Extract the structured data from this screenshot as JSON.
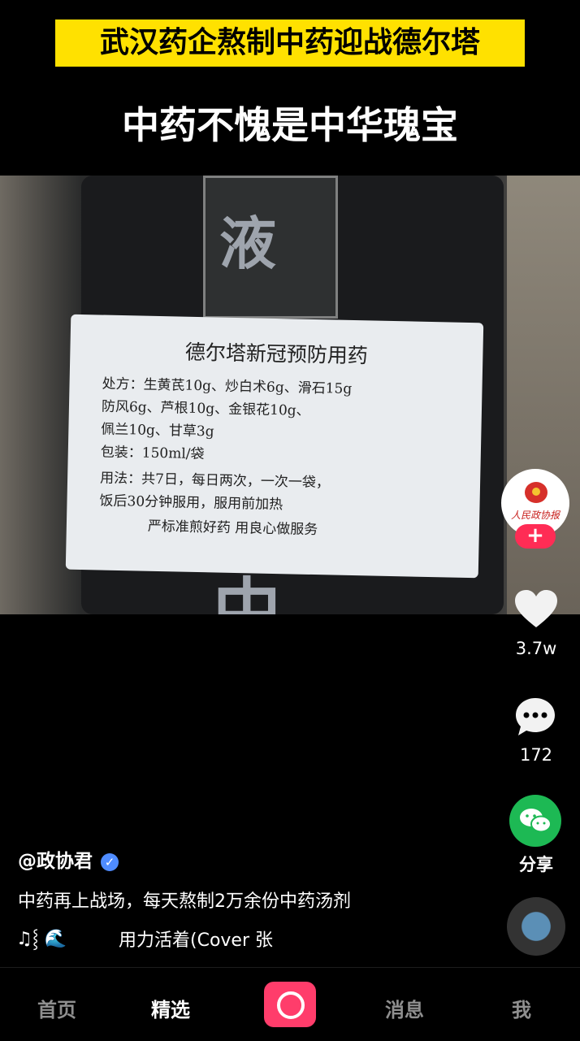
{
  "overlay": {
    "headline": "武汉药企熬制中药迎战德尔塔",
    "subheadline": "中药不愧是中华瑰宝"
  },
  "video": {
    "bag_chars": [
      "液",
      "中"
    ],
    "label": {
      "title": "德尔塔新冠预防用药",
      "lines": [
        "处方：生黄芪10g、炒白术6g、滑石15g",
        "防风6g、芦根10g、金银花10g、",
        "佩兰10g、甘草3g",
        "包装：150ml/袋",
        "用法：共7日，每日两次，一次一袋，",
        "饭后30分钟服用，服用前加热",
        "严标准煎好药 用良心做服务"
      ]
    }
  },
  "sidebar": {
    "avatar_text": "人民政协报",
    "follow_label": "+",
    "likes": "3.7w",
    "comments": "172",
    "share_label": "分享"
  },
  "post": {
    "username": "@政协君",
    "caption": "中药再上战场，每天熬制2万余份中药汤剂",
    "music_icons": "♫⸾ 🌊",
    "song": "用力活着(Cover 张"
  },
  "nav": {
    "home": "首页",
    "featured": "精选",
    "messages": "消息",
    "me": "我"
  },
  "colors": {
    "banner": "#ffe100",
    "accent": "#ff2c55",
    "share": "#1db954",
    "verified": "#4f8cff"
  }
}
